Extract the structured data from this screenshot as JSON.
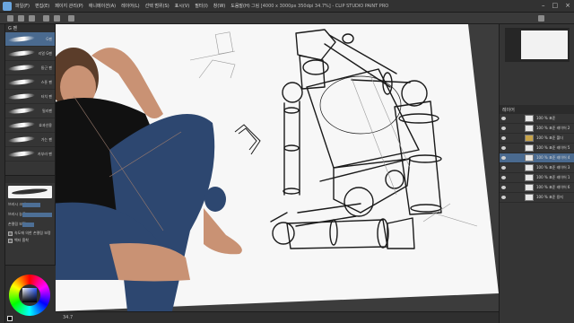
{
  "app": {
    "window_title": "그림 [4000 x 3000px 350dpi 34.7%]  - CLIP STUDIO PAINT PRO",
    "menu": [
      "파일(F)",
      "편집(E)",
      "페이지 관리(P)",
      "애니메이션(A)",
      "레이어(L)",
      "선택 범위(S)",
      "표시(V)",
      "필터(I)",
      "창(W)",
      "도움말(H)"
    ],
    "accent_color": "#4a6a8f"
  },
  "brush_panel": {
    "tab_label": "G 펜",
    "items": [
      {
        "label": "G펜"
      },
      {
        "label": "리얼 G펜"
      },
      {
        "label": "둥근 펜"
      },
      {
        "label": "스푼 펜"
      },
      {
        "label": "터치 펜"
      },
      {
        "label": "밀리펜"
      },
      {
        "label": "효과선용"
      },
      {
        "label": "가는 펜"
      },
      {
        "label": "카부라 펜"
      }
    ]
  },
  "tool_property": {
    "rows": [
      {
        "label": "브러시 크기",
        "value": 0.6
      },
      {
        "label": "브러시 농도",
        "value": 1.0
      },
      {
        "label": "손떨림 보정",
        "value": 0.4
      }
    ],
    "checks": [
      "속도에 의한 손떨림 보정",
      "벡터 흡착"
    ]
  },
  "layers": {
    "header": "레이어",
    "items": [
      {
        "name": "100 % 표준",
        "type": "layer"
      },
      {
        "name": "100 % 표준 레이어 2",
        "type": "layer"
      },
      {
        "name": "100 % 표준 폴더",
        "type": "folder"
      },
      {
        "name": "100 % 표준 레이어 5",
        "type": "layer"
      },
      {
        "name": "100 % 표준 레이어 4",
        "type": "layer",
        "selected": true
      },
      {
        "name": "100 % 표준 레이어 3",
        "type": "layer"
      },
      {
        "name": "100 % 표준 레이어 1",
        "type": "layer"
      },
      {
        "name": "100 % 표준 레이어 6",
        "type": "layer"
      },
      {
        "name": "100 % 표준 용지",
        "type": "layer"
      }
    ]
  },
  "status": {
    "zoom": "34.7"
  }
}
